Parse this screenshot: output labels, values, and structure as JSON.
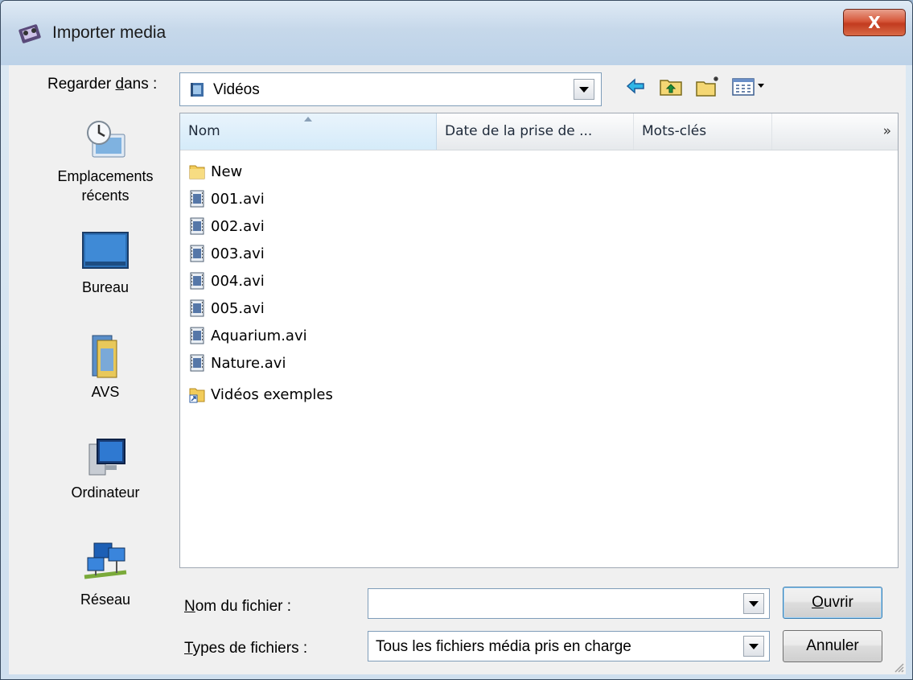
{
  "window": {
    "title": "Importer media",
    "close_glyph": "X"
  },
  "look_in": {
    "label_prefix": "Regarder ",
    "label_accel": "d",
    "label_suffix": "ans :",
    "value": "Vidéos"
  },
  "toolbar": {
    "icons": [
      "back-arrow-icon",
      "up-folder-icon",
      "new-folder-icon",
      "view-menu-icon"
    ]
  },
  "places": [
    {
      "label": "Emplacements récents",
      "icon": "recent-places-icon"
    },
    {
      "label": "Bureau",
      "icon": "desktop-icon"
    },
    {
      "label": "AVS",
      "icon": "avs-icon"
    },
    {
      "label": "Ordinateur",
      "icon": "computer-icon"
    },
    {
      "label": "Réseau",
      "icon": "network-icon"
    }
  ],
  "columns": {
    "name": "Nom",
    "date": "Date de la prise de ...",
    "keywords": "Mots-clés",
    "more": "»"
  },
  "files": [
    {
      "name": "New",
      "type": "folder"
    },
    {
      "name": "001.avi",
      "type": "video"
    },
    {
      "name": "002.avi",
      "type": "video"
    },
    {
      "name": "003.avi",
      "type": "video"
    },
    {
      "name": "004.avi",
      "type": "video"
    },
    {
      "name": "005.avi",
      "type": "video"
    },
    {
      "name": "Aquarium.avi",
      "type": "video"
    },
    {
      "name": "Nature.avi",
      "type": "video"
    },
    {
      "name": "Vidéos exemples",
      "type": "shortcut-folder"
    }
  ],
  "filename": {
    "label_accel": "N",
    "label_rest": "om du fichier :",
    "value": ""
  },
  "filetype": {
    "label_accel": "T",
    "label_rest": "ypes de fichiers :",
    "value": "Tous les fichiers média pris en charge"
  },
  "buttons": {
    "open_accel": "O",
    "open_rest": "uvrir",
    "cancel": "Annuler"
  }
}
